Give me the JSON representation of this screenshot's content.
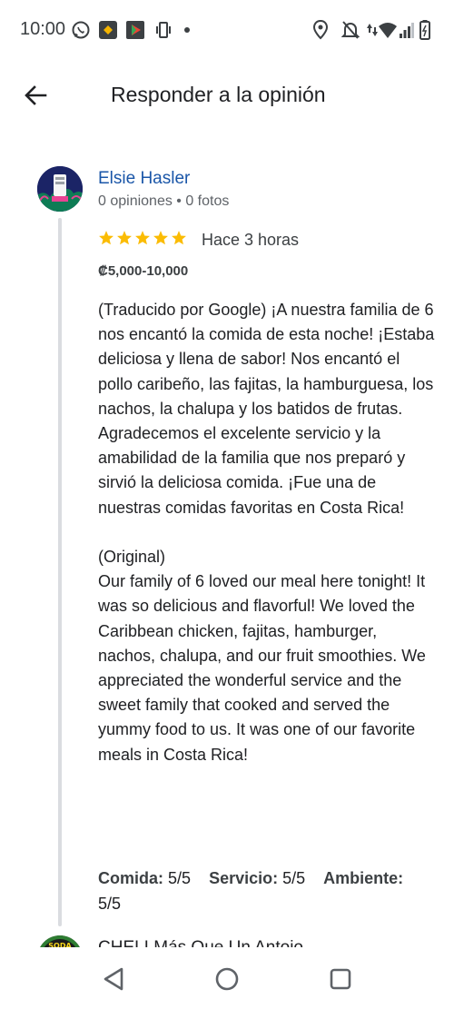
{
  "status_bar": {
    "time": "10:00",
    "icons": [
      "whatsapp-icon",
      "app-notification-icon",
      "play-icon",
      "vibrate-icon",
      "dot-icon",
      "location-icon",
      "do-not-disturb-icon",
      "data-icon",
      "wifi-icon",
      "signal-icon",
      "battery-icon"
    ]
  },
  "app_bar": {
    "back_icon": "arrow-back-icon",
    "title": "Responder a la opinión"
  },
  "review": {
    "author": "Elsie Hasler",
    "meta": "0 opiniones • 0 fotos",
    "rating": 5,
    "star_color": "#fbbc04",
    "time": "Hace 3 horas",
    "price": "₡5,000-10,000",
    "text": "(Traducido por Google) ¡A nuestra familia de 6 nos encantó la comida de esta noche! ¡Estaba deliciosa y llena de sabor! Nos encantó el pollo caribeño, las fajitas, la hamburguesa, los nachos, la chalupa y los batidos de frutas. Agradecemos el excelente servicio y la amabilidad de la familia que nos preparó y sirvió la deliciosa comida. ¡Fue una de nuestras comidas favoritas en Costa Rica!\n\n(Original)\nOur family of 6 loved our meal here tonight! It was so delicious and flavorful! We loved the Caribbean chicken, fajitas, hamburger, nachos, chalupa, and our fruit smoothies. We appreciated the wonderful service and the sweet family that cooked and served the yummy food to us. It was one of our favorite meals in Costa Rica!",
    "ratings": [
      {
        "label": "Comida:",
        "value": "5/5"
      },
      {
        "label": "Servicio:",
        "value": "5/5"
      },
      {
        "label": "Ambiente:",
        "value": "5/5"
      }
    ]
  },
  "next_review": {
    "name": "CHELI Más Que Un Antojo",
    "avatar_text": "SODA"
  },
  "nav_bar": {
    "buttons": [
      "back-triangle-icon",
      "home-circle-icon",
      "recents-square-icon"
    ]
  },
  "colors": {
    "link": "#1a56a8",
    "thread_line": "#dadce0",
    "text": "#202124",
    "secondary": "#5f6368"
  }
}
